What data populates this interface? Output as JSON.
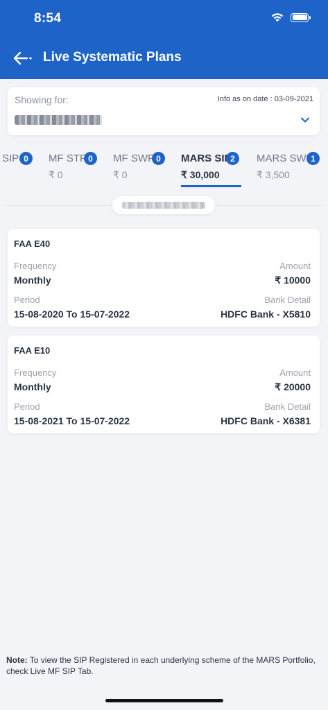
{
  "status_bar": {
    "time": "8:54"
  },
  "header": {
    "title": "Live Systematic Plans"
  },
  "showing": {
    "label": "Showing for:",
    "info_date": "Info as on date : 03-09-2021"
  },
  "tabs": [
    {
      "label": "SIP",
      "count": "0",
      "amount": ""
    },
    {
      "label": "MF STP",
      "count": "0",
      "amount": "₹ 0"
    },
    {
      "label": "MF SWP",
      "count": "0",
      "amount": "₹ 0"
    },
    {
      "label": "MARS SIP",
      "count": "2",
      "amount": "₹ 30,000"
    },
    {
      "label": "MARS SWP",
      "count": "1",
      "amount": "₹ 3,500"
    }
  ],
  "plans": [
    {
      "name": "FAA E40",
      "frequency_label": "Frequency",
      "frequency": "Monthly",
      "amount_label": "Amount",
      "amount": "₹ 10000",
      "period_label": "Period",
      "period": "15-08-2020 To 15-07-2022",
      "bank_label": "Bank Detail",
      "bank": "HDFC Bank - X5810"
    },
    {
      "name": "FAA E10",
      "frequency_label": "Frequency",
      "frequency": "Monthly",
      "amount_label": "Amount",
      "amount": "₹ 20000",
      "period_label": "Period",
      "period": "15-08-2021 To 15-07-2022",
      "bank_label": "Bank Detail",
      "bank": "HDFC Bank - X6381"
    }
  ],
  "note": {
    "prefix": "Note:",
    "text": " To view the SIP Registered in each underlying scheme of the MARS Portfolio, check Live MF SIP Tab."
  },
  "colors": {
    "brand": "#1e63c8",
    "background": "#f3f4f8"
  }
}
